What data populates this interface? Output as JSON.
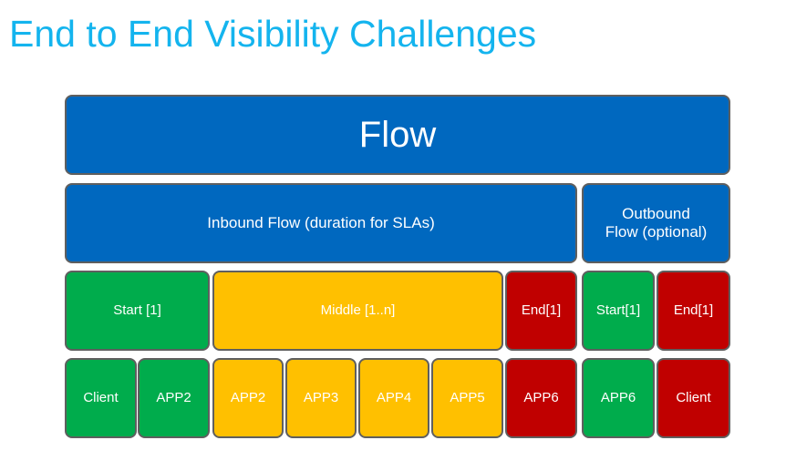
{
  "title": "End to End Visibility Challenges",
  "colors": {
    "title": "#14b4ee",
    "flow": "#0068bf",
    "start": "#00ac4c",
    "middle": "#ffc000",
    "end": "#c00000",
    "border": "#5f5f5f"
  },
  "flow": {
    "label": "Flow"
  },
  "inbound": {
    "label": "Inbound Flow (duration for SLAs)"
  },
  "outbound": {
    "label_line1": "Outbound",
    "label_line2": "Flow (optional)"
  },
  "phases": {
    "inbound_start": "Start [1]",
    "inbound_middle": "Middle [1..n]",
    "inbound_end": "End[1]",
    "outbound_start": "Start[1]",
    "outbound_end": "End[1]"
  },
  "apps": {
    "inbound_start": [
      "Client",
      "APP2"
    ],
    "inbound_middle": [
      "APP2",
      "APP3",
      "APP4",
      "APP5"
    ],
    "inbound_end": [
      "APP6"
    ],
    "outbound_start": [
      "APP6"
    ],
    "outbound_end": [
      "Client"
    ]
  }
}
